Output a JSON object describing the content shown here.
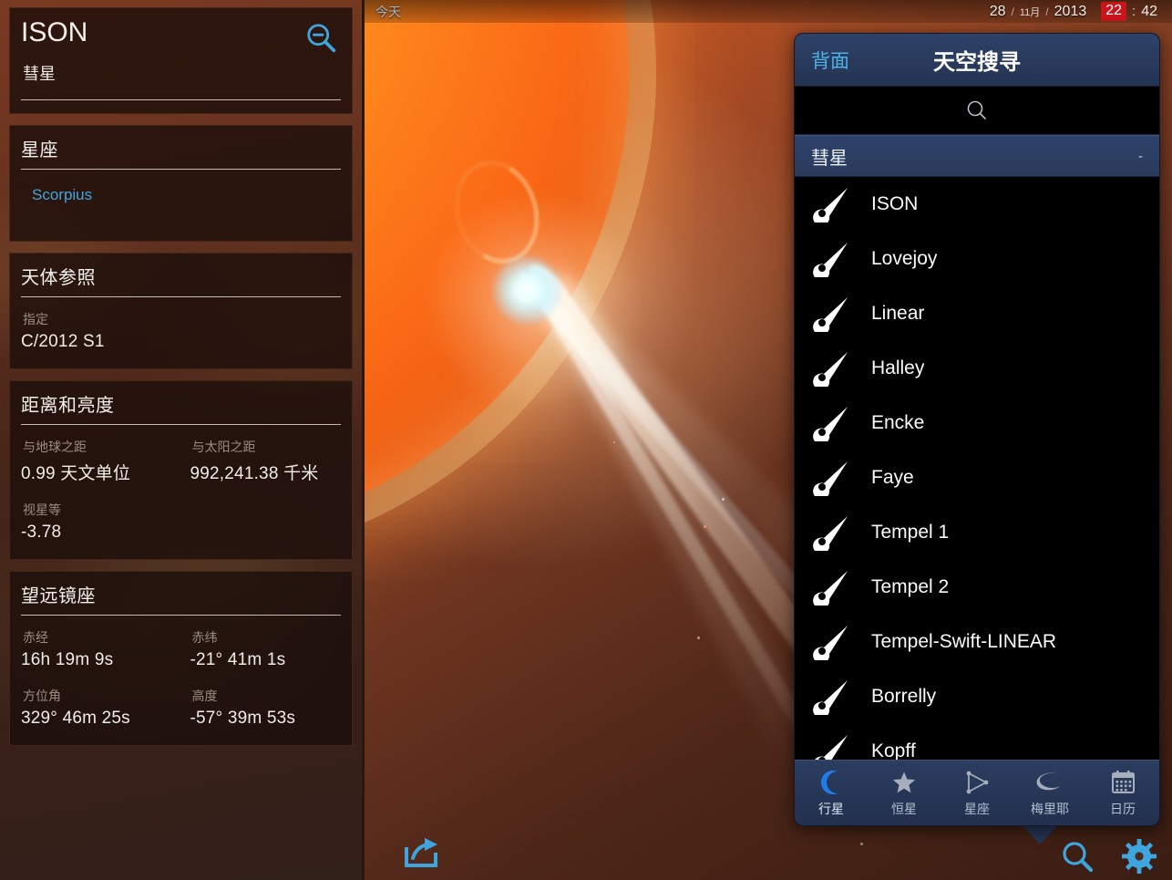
{
  "app": {
    "topbar": {
      "today_label": "今天",
      "day": "28",
      "month": "11月",
      "year": "2013",
      "hour": "22",
      "colon": ":",
      "minute": "42",
      "slash": "/",
      "hour_highlight_color": "#c8141b"
    }
  },
  "info_panel": {
    "object_name": "ISON",
    "object_type": "彗星",
    "zoom_out_icon": "magnifier-minus-icon",
    "cards": [
      {
        "title": "星座",
        "link": "Scorpius"
      },
      {
        "title": "天体参照",
        "fields": [
          {
            "label": "指定",
            "value": "C/2012 S1"
          }
        ]
      },
      {
        "title": "距离和亮度",
        "fields": [
          {
            "label": "与地球之距",
            "value": "0.99 天文单位"
          },
          {
            "label": "与太阳之距",
            "value": "992,241.38 千米"
          },
          {
            "label": "视星等",
            "value": "-3.78"
          }
        ]
      },
      {
        "title": "望远镜座",
        "fields": [
          {
            "label": "赤经",
            "value": "16h 19m 9s"
          },
          {
            "label": "赤纬",
            "value": "-21° 41m 1s"
          },
          {
            "label": "方位角",
            "value": "329° 46m 25s"
          },
          {
            "label": "高度",
            "value": "-57° 39m 53s"
          }
        ]
      }
    ]
  },
  "search_popover": {
    "back_label": "背面",
    "title": "天空搜寻",
    "search_placeholder": "",
    "search_icon": "search-icon",
    "section": {
      "label": "彗星",
      "value": "-"
    },
    "items": [
      {
        "name": "ISON",
        "icon": "comet-icon"
      },
      {
        "name": "Lovejoy",
        "icon": "comet-icon"
      },
      {
        "name": "Linear",
        "icon": "comet-icon"
      },
      {
        "name": "Halley",
        "icon": "comet-icon"
      },
      {
        "name": "Encke",
        "icon": "comet-icon"
      },
      {
        "name": "Faye",
        "icon": "comet-icon"
      },
      {
        "name": "Tempel 1",
        "icon": "comet-icon"
      },
      {
        "name": "Tempel 2",
        "icon": "comet-icon"
      },
      {
        "name": "Tempel-Swift-LINEAR",
        "icon": "comet-icon"
      },
      {
        "name": "Borrelly",
        "icon": "comet-icon"
      },
      {
        "name": "Kopff",
        "icon": "comet-icon"
      }
    ],
    "tabs": [
      {
        "label": "行星",
        "icon": "moon-icon",
        "active": true
      },
      {
        "label": "恒星",
        "icon": "star-icon",
        "active": false
      },
      {
        "label": "星座",
        "icon": "constellation-icon",
        "active": false
      },
      {
        "label": "梅里耶",
        "icon": "galaxy-icon",
        "active": false
      },
      {
        "label": "日历",
        "icon": "calendar-icon",
        "active": false
      }
    ]
  },
  "toolbar": {
    "share_icon": "share-icon",
    "search_icon": "search-icon",
    "settings_icon": "gear-icon"
  },
  "colors": {
    "accent_blue": "#3fa5de",
    "panel_navy": "#2a3a5c",
    "sky_orange": "#f0741e",
    "highlight_red": "#c8141b"
  }
}
